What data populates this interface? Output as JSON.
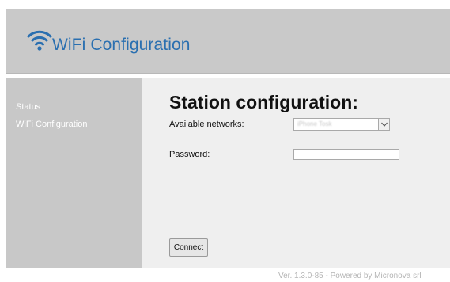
{
  "header": {
    "logo_icon": "wifi-icon",
    "title": "WiFi Configuration",
    "accent_color": "#2a6fb0"
  },
  "sidebar": {
    "items": [
      {
        "label": "Status"
      },
      {
        "label": "WiFi Configuration"
      }
    ]
  },
  "main": {
    "title": "Station configuration:",
    "networks_label": "Available networks:",
    "networks_selected": "iPhone Tosk",
    "password_label": "Password:",
    "password_value": "",
    "connect_label": "Connect"
  },
  "footer": {
    "text": "Ver. 1.3.0-85 - Powered by Micronova srl"
  }
}
